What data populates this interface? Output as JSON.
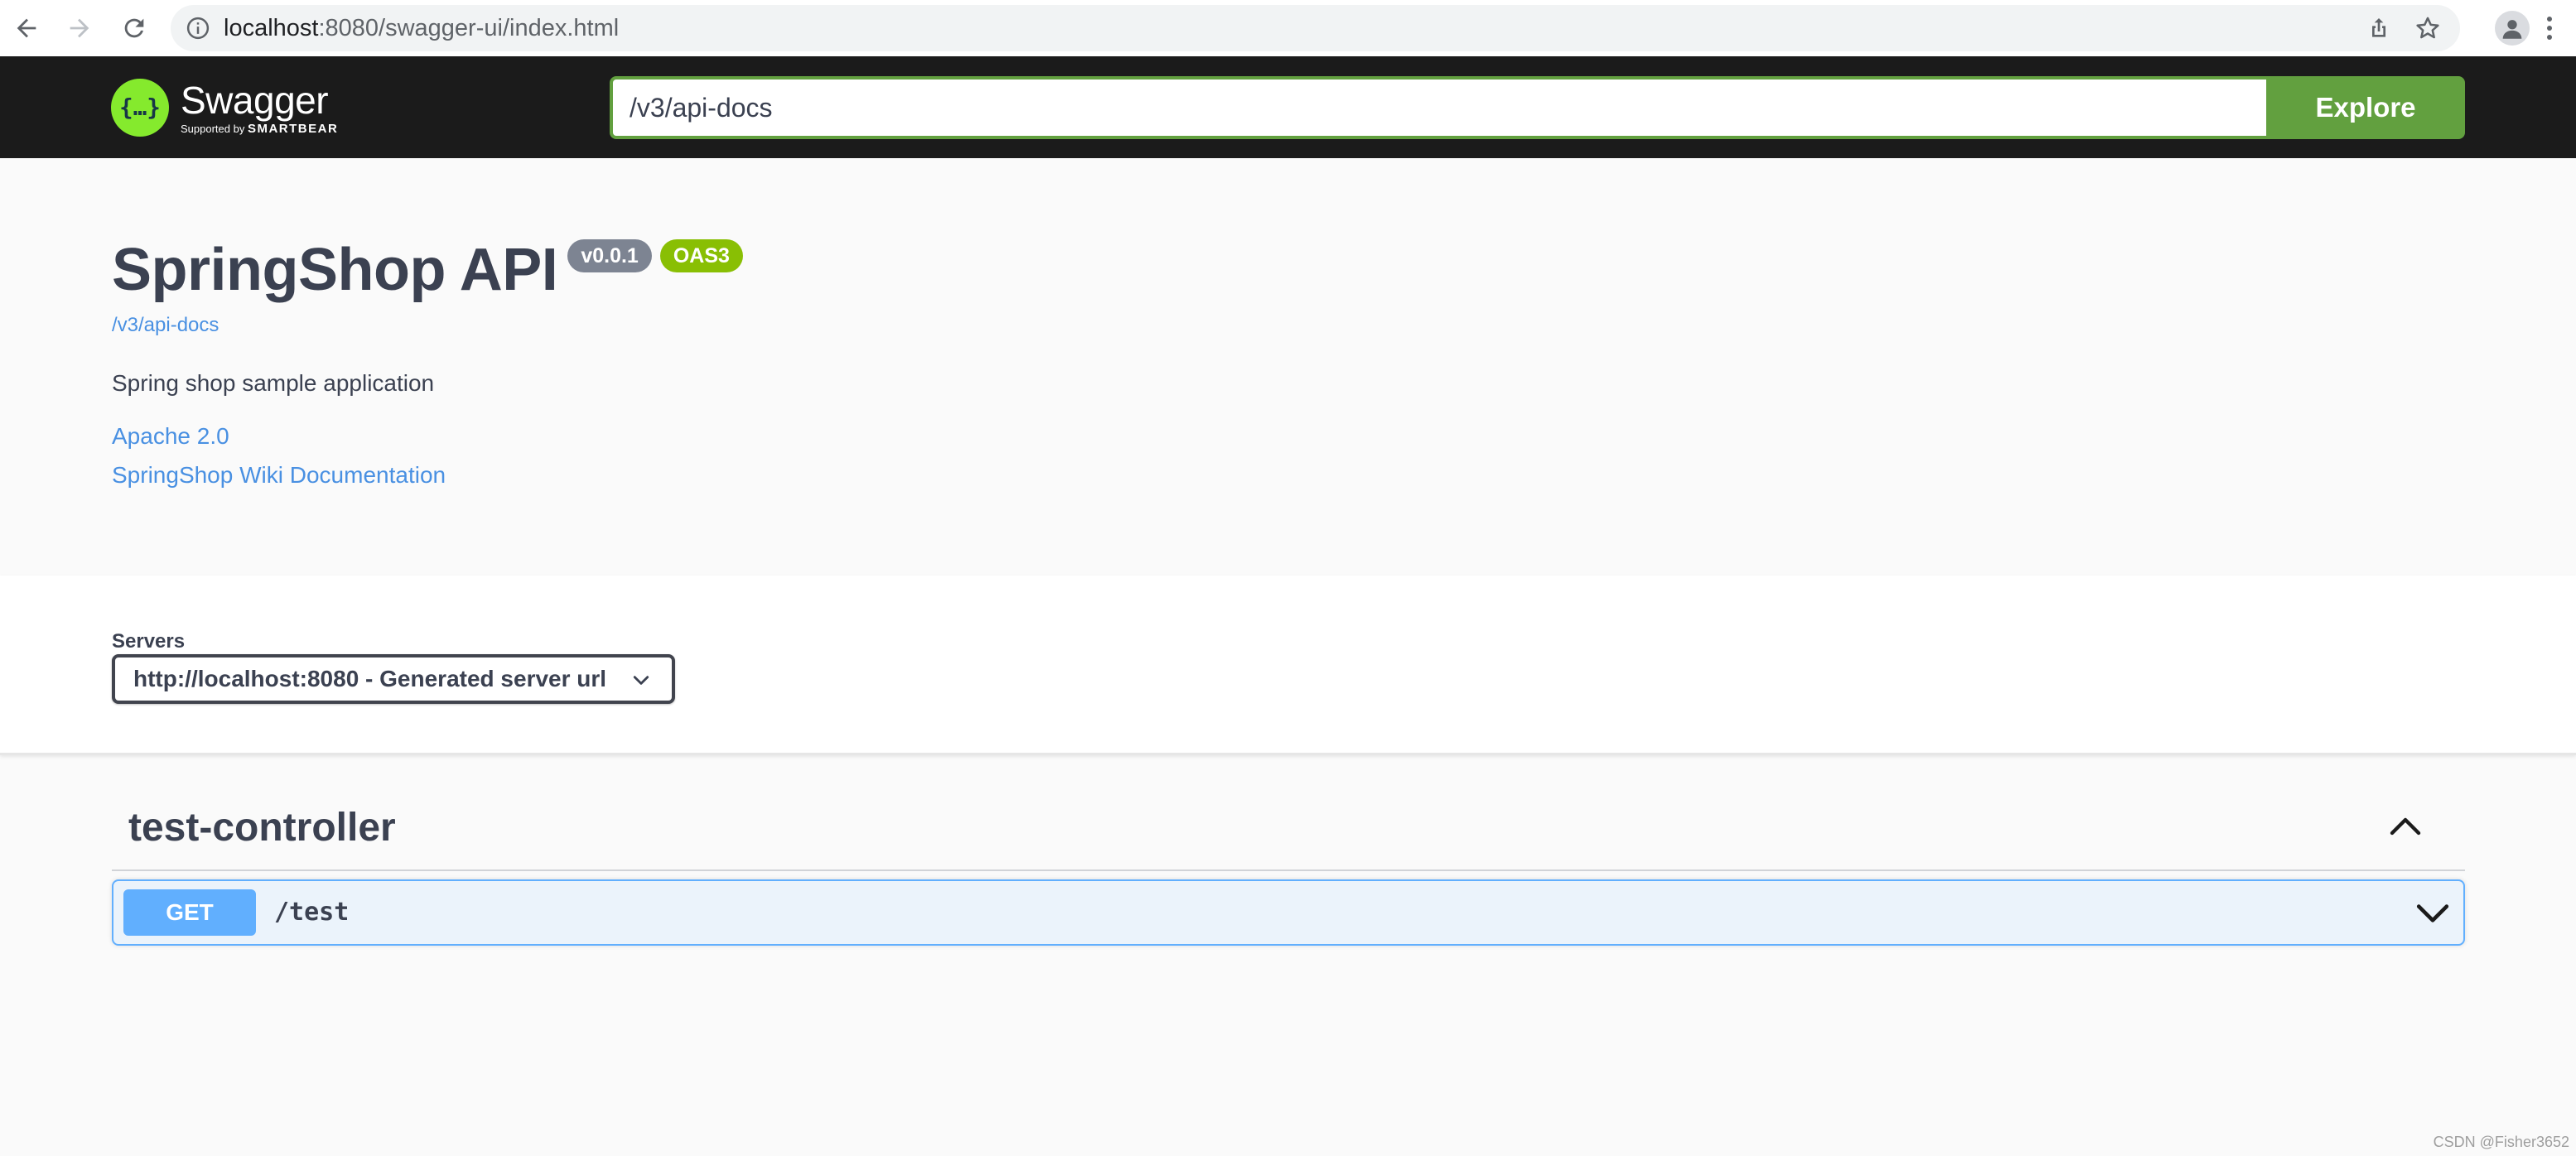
{
  "browser": {
    "url_host": "localhost",
    "url_rest": ":8080/swagger-ui/index.html"
  },
  "topbar": {
    "logo_name": "Swagger",
    "logo_sub_prefix": "Supported by",
    "logo_sub_brand": "SMARTBEAR",
    "explore_value": "/v3/api-docs",
    "explore_label": "Explore"
  },
  "info": {
    "title": "SpringShop API",
    "version_badge": "v0.0.1",
    "oas_badge": "OAS3",
    "spec_link": "/v3/api-docs",
    "description": "Spring shop sample application",
    "license_link": "Apache 2.0",
    "docs_link": "SpringShop Wiki Documentation"
  },
  "servers": {
    "label": "Servers",
    "selected": "http://localhost:8080 - Generated server url"
  },
  "operations": {
    "tag": "test-controller",
    "items": [
      {
        "method": "GET",
        "path": "/test"
      }
    ]
  },
  "watermark": "CSDN @Fisher3652",
  "colors": {
    "topbar_bg": "#1b1b1b",
    "swagger_green": "#85ea2d",
    "explore_green": "#62a03f",
    "get_blue": "#61affe",
    "version_gray": "#7d8492",
    "oas_green": "#89bf04",
    "link_blue": "#4990e2"
  }
}
